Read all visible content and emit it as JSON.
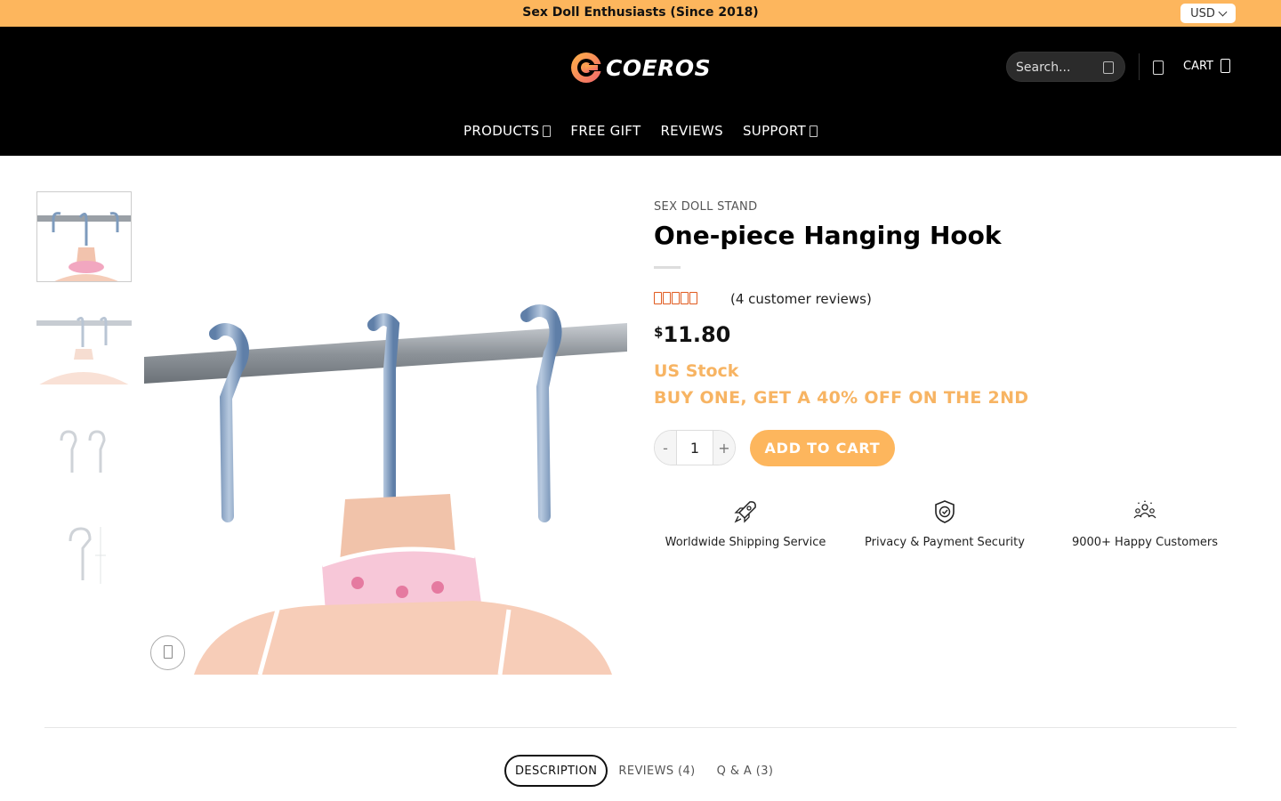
{
  "topbar": {
    "promo": "Sex Doll Enthusiasts (Since 2018)",
    "currency": "USD"
  },
  "header": {
    "logo_text": "COEROS",
    "search_placeholder": "Search...",
    "cart_label": "CART",
    "nav": [
      "PRODUCTS",
      "FREE GIFT",
      "REVIEWS",
      "SUPPORT"
    ]
  },
  "gallery": {
    "thumbnail_count": 4
  },
  "product": {
    "category": "SEX DOLL STAND",
    "title": "One-piece Hanging Hook",
    "rating": 5,
    "reviews_text": "(4 customer reviews)",
    "currency_symbol": "$",
    "price": "11.80",
    "stock": "US Stock",
    "promo": "BUY ONE, GET A 40% OFF ON THE 2ND",
    "quantity": "1",
    "minus": "-",
    "plus": "+",
    "add_to_cart": "ADD TO CART"
  },
  "features": [
    {
      "label": "Worldwide Shipping Service",
      "icon": "rocket-icon"
    },
    {
      "label": "Privacy & Payment Security",
      "icon": "shield-check-icon"
    },
    {
      "label": "9000+ Happy Customers",
      "icon": "customers-icon"
    }
  ],
  "tabs": [
    "DESCRIPTION",
    "REVIEWS (4)",
    "Q & A (3)"
  ],
  "colors": {
    "accent": "#fdb65d",
    "header_bg": "#000000",
    "star": "#e05a1e"
  }
}
